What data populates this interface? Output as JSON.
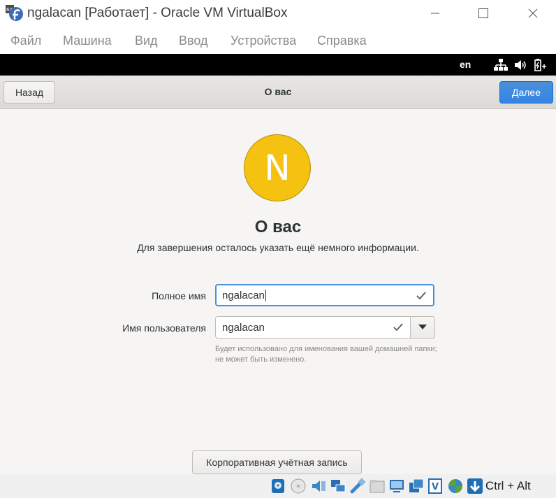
{
  "window": {
    "title": "ngalacan [Работает] - Oracle VM VirtualBox",
    "icon": "virtualbox-fedora-icon",
    "controls": [
      "minimize-icon",
      "maximize-icon",
      "close-icon"
    ]
  },
  "menubar": {
    "items": [
      "Файл",
      "Машина",
      "Вид",
      "Ввод",
      "Устройства",
      "Справка"
    ]
  },
  "guest_topbar": {
    "keyboard_layout": "en",
    "icons": [
      "network-icon",
      "volume-icon",
      "battery-icon"
    ]
  },
  "header": {
    "back_label": "Назад",
    "title": "О вас",
    "next_label": "Далее",
    "accent": "#3584e4"
  },
  "main": {
    "avatar_letter": "N",
    "avatar_color": "#f5c211",
    "heading": "О вас",
    "subtitle": "Для завершения осталось указать ещё немного информации.",
    "full_name_label": "Полное имя",
    "full_name_value": "ngalacan",
    "username_label": "Имя пользователя",
    "username_value": "ngalacan",
    "username_hint": "Будет использовано для именования вашей домашней папки; не может быть изменено.",
    "enterprise_label": "Корпоративная учётная запись"
  },
  "statusbar": {
    "icons": [
      "hard-disk-icon",
      "optical-drive-icon",
      "audio-icon",
      "network-adapter-icon",
      "usb-icon",
      "shared-folders-icon",
      "display-icon",
      "recording-icon",
      "virtualization-icon",
      "guest-additions-icon",
      "mouse-integration-icon"
    ],
    "host_key": "Ctrl + Alt"
  }
}
